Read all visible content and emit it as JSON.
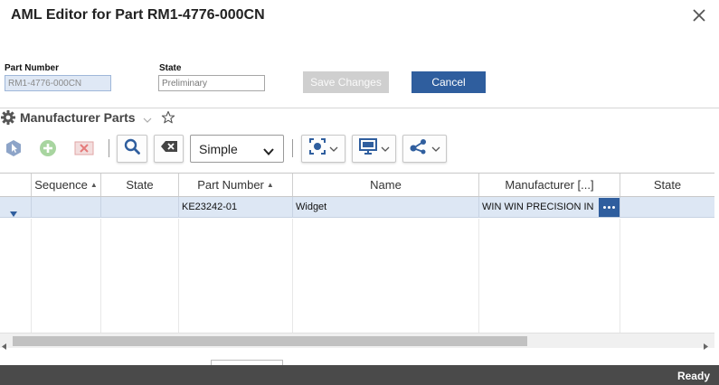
{
  "dialog": {
    "title": "AML Editor for Part RM1-4776-000CN",
    "close_icon": "close-icon"
  },
  "form": {
    "part_number_label": "Part Number",
    "part_number_value": "RM1-4776-000CN",
    "state_label": "State",
    "state_value": "Preliminary",
    "save_label": "Save Changes",
    "save_state": "disabled",
    "cancel_label": "Cancel"
  },
  "section": {
    "title": "Manufacturer Parts",
    "icons": [
      "gear-icon",
      "chevron-down-icon",
      "star-icon"
    ]
  },
  "toolbar": {
    "icons": [
      "pointer-icon",
      "add-icon",
      "remove-icon",
      "search-icon",
      "clear-icon",
      "capture-icon",
      "display-icon",
      "share-icon"
    ],
    "search_mode": "Simple"
  },
  "grid": {
    "columns": [
      {
        "label": "",
        "sort": ""
      },
      {
        "label": "Sequence",
        "sort": "▲"
      },
      {
        "label": "State",
        "sort": ""
      },
      {
        "label": "Part Number",
        "sort": "▲"
      },
      {
        "label": "Name",
        "sort": ""
      },
      {
        "label": "Manufacturer [...]",
        "sort": ""
      },
      {
        "label": "State",
        "sort": ""
      }
    ],
    "rows": [
      {
        "sequence": "",
        "state": "",
        "part_number": "KE23242-01",
        "name": "Widget",
        "manufacturer": "WIN WIN PRECISION IN",
        "mfr_state": ""
      }
    ]
  },
  "scrollbar": {
    "position_fraction": 0.0,
    "visible_fraction": 0.73
  },
  "status": {
    "text": "Ready"
  },
  "colors": {
    "accent": "#2f5e9e",
    "selected_row": "#dde7f4",
    "status_bar": "#4a4a4a"
  }
}
